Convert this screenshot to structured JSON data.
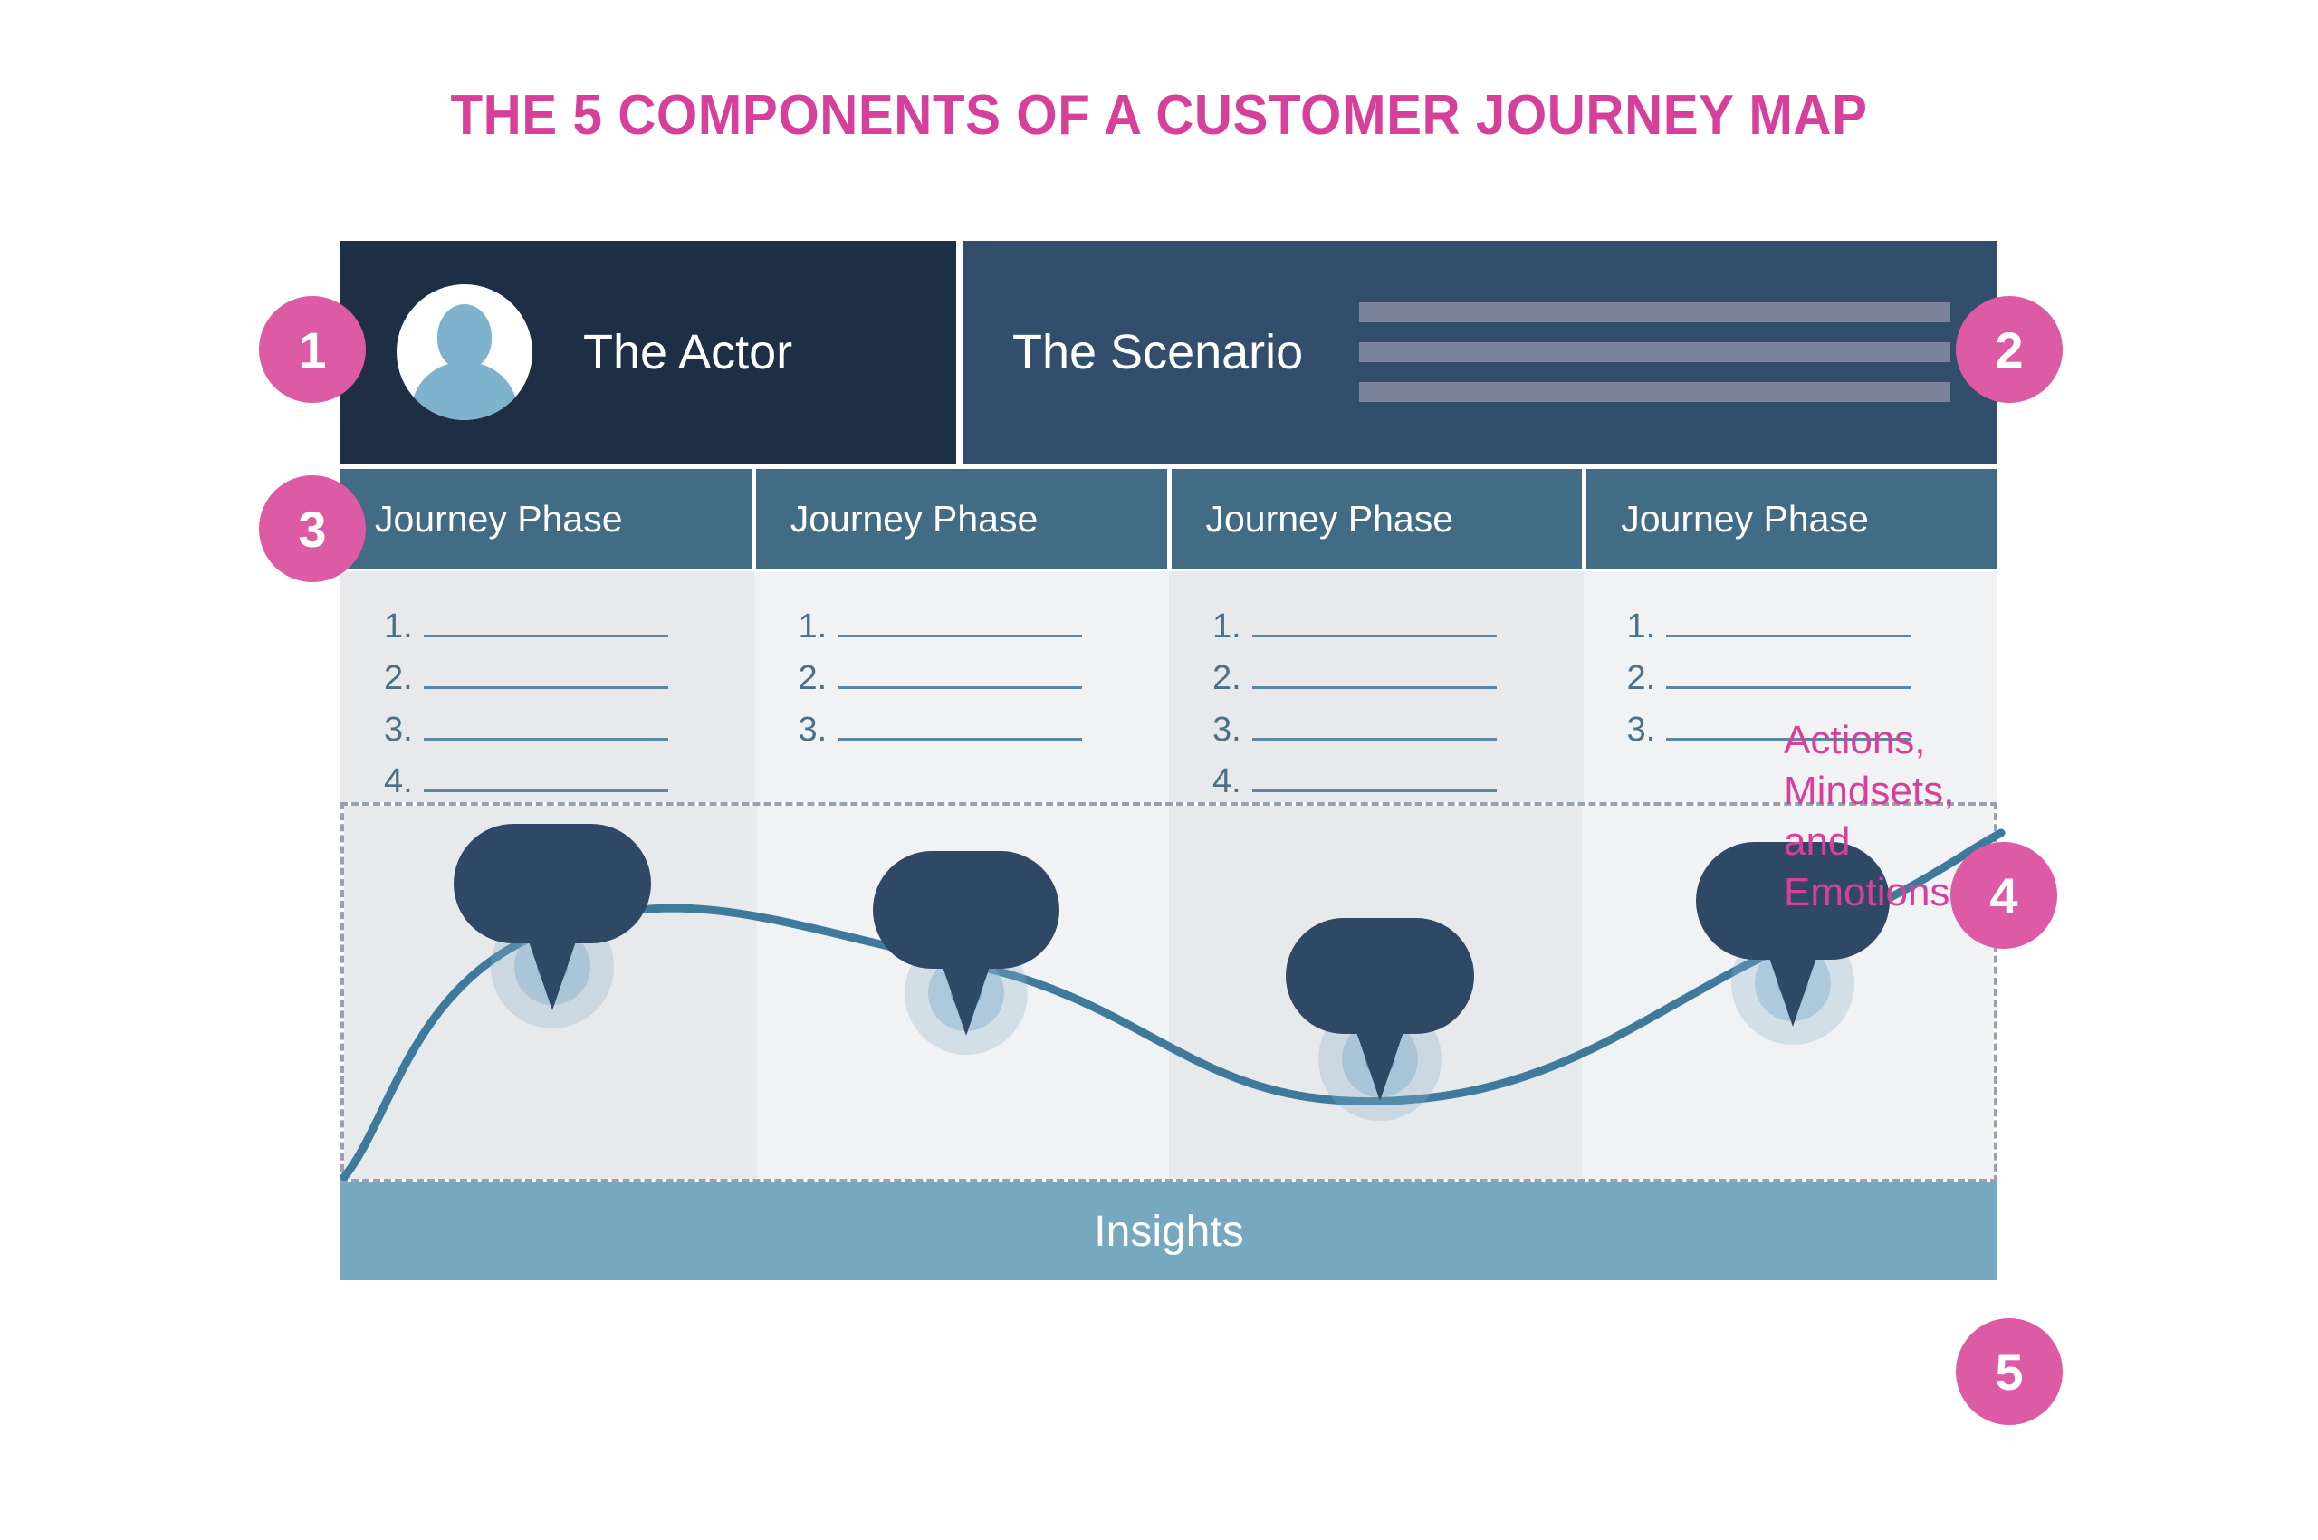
{
  "title": "THE 5 COMPONENTS OF A CUSTOMER JOURNEY MAP",
  "colors": {
    "accent_pink": "#D6409A",
    "badge_pink": "#DD5BA5",
    "actor_navy": "#1E2E44",
    "scenario_navy": "#334E6C",
    "phase_blue": "#426C86",
    "insights_blue": "#76A9C0",
    "bubble_navy": "#2E4866",
    "curve_blue": "#3D7A9C",
    "column_shade_a": "#E7E9EA",
    "column_shade_b": "#F1F2F3",
    "dashed_border": "#97A0B4",
    "scenario_bar": "#7C849B"
  },
  "components": {
    "actor": {
      "badge": "1",
      "label": "The Actor",
      "avatar_icon": "person-avatar-icon"
    },
    "scenario": {
      "badge": "2",
      "label": "The Scenario",
      "placeholder_bars": 3
    },
    "journey_phases": {
      "badge": "3",
      "headers": [
        "Journey Phase",
        "Journey Phase",
        "Journey Phase",
        "Journey Phase"
      ],
      "columns": [
        {
          "items": [
            "1.",
            "2.",
            "3.",
            "4."
          ]
        },
        {
          "items": [
            "1.",
            "2.",
            "3."
          ]
        },
        {
          "items": [
            "1.",
            "2.",
            "3.",
            "4."
          ]
        },
        {
          "items": [
            "1.",
            "2.",
            "3."
          ]
        }
      ]
    },
    "emotions": {
      "badge": "4",
      "callout_lines": [
        "Actions,",
        "Mindsets,",
        "and",
        "Emotions"
      ]
    },
    "insights": {
      "badge": "5",
      "label": "Insights"
    }
  },
  "chart_data": {
    "type": "line",
    "title": "Actions, Mindsets, and Emotions",
    "xlabel": "",
    "ylabel": "",
    "categories": [
      "Journey Phase 1",
      "Journey Phase 2",
      "Journey Phase 3",
      "Journey Phase 4"
    ],
    "x": [
      0,
      230,
      687,
      1144,
      1600,
      1830
    ],
    "values": [
      0,
      72,
      62,
      22,
      68,
      100
    ],
    "ylim": [
      0,
      100
    ],
    "grid": false,
    "legend": null,
    "markers": [
      {
        "x": 230,
        "y": 72,
        "bubble": true
      },
      {
        "x": 687,
        "y": 62,
        "bubble": true
      },
      {
        "x": 1144,
        "y": 22,
        "bubble": true
      },
      {
        "x": 1600,
        "y": 68,
        "bubble": true
      }
    ],
    "annotations": [
      "Actions, Mindsets, and Emotions"
    ]
  }
}
